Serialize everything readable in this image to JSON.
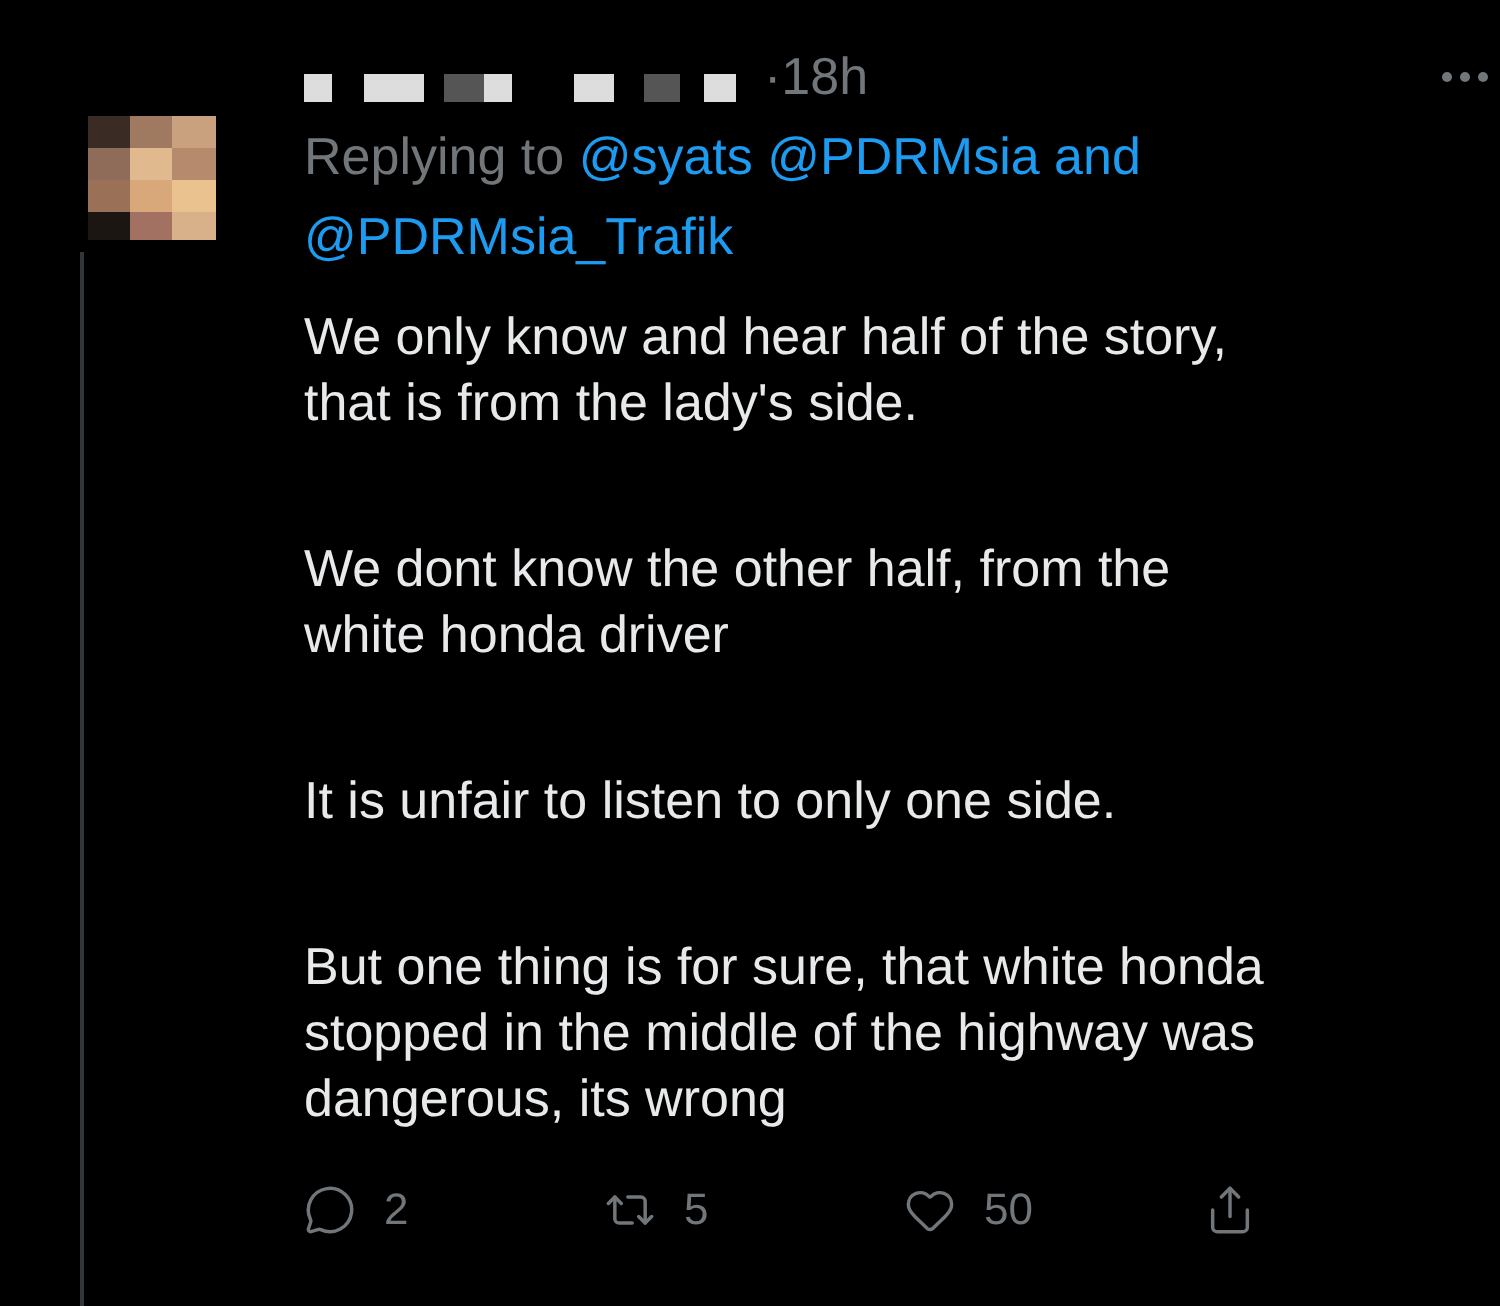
{
  "tweet": {
    "time": "18h",
    "separator": "·",
    "reply_to": {
      "label": "Replying to",
      "mentions": [
        "@syats",
        "@PDRMsia"
      ],
      "conjunction": "and",
      "last_mention": "@PDRMsia_Trafik"
    },
    "paragraphs": [
      [
        "We only know and hear half of the story,",
        "that is from the lady's side."
      ],
      [
        "We dont know the other half, from the",
        "white honda driver"
      ],
      [
        "It is unfair to listen to only one side."
      ],
      [
        "But one thing is for sure, that white honda",
        "stopped in the middle of the highway was",
        "dangerous, its wrong"
      ]
    ],
    "actions": [
      {
        "kind": "reply",
        "count": "2"
      },
      {
        "kind": "retweet",
        "count": "5"
      },
      {
        "kind": "like",
        "count": "50"
      },
      {
        "kind": "share"
      }
    ]
  }
}
